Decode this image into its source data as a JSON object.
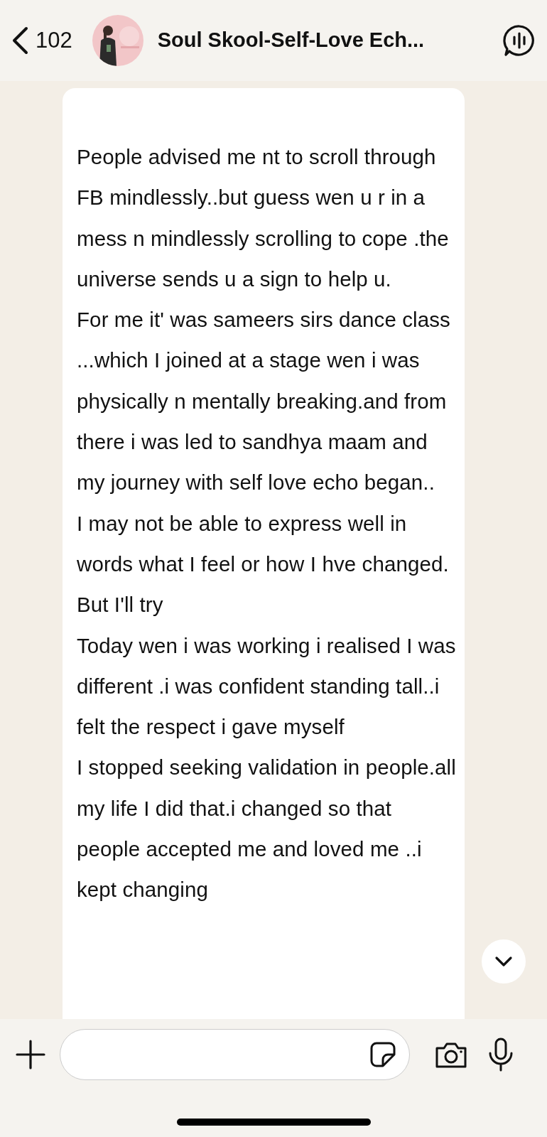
{
  "header": {
    "back_count": "102",
    "title": "Soul Skool-Self-Love Ech..."
  },
  "message": {
    "paragraphs": [
      "People advised  me nt to scroll through FB mindlessly..but guess wen u r in a mess n mindlessly scrolling to cope .the universe sends u a sign to help u.",
      "For me it' was sameers sirs dance class ...which I joined at a stage wen i was physically n mentally breaking.and from there i was led to sandhya maam and my journey with self love echo began..",
      "I may not be able to express well in words what I feel or how I hve changed. But I'll try",
      "Today wen i was working i realised I was different .i was confident standing tall..i felt the respect i gave myself",
      "I stopped seeking validation in people.all my life I did that.i changed so that people accepted me and loved me ..i kept changing"
    ]
  }
}
